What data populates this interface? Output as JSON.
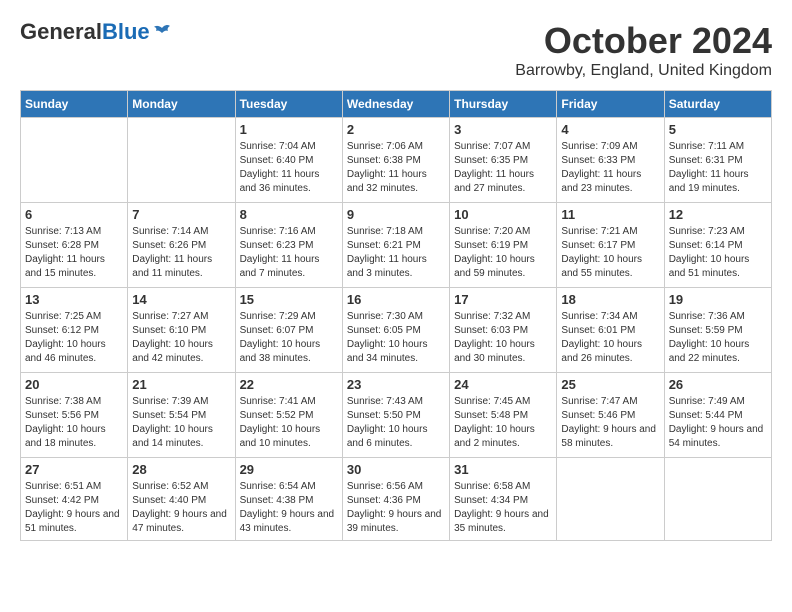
{
  "header": {
    "logo_general": "General",
    "logo_blue": "Blue",
    "month_title": "October 2024",
    "location": "Barrowby, England, United Kingdom"
  },
  "weekdays": [
    "Sunday",
    "Monday",
    "Tuesday",
    "Wednesday",
    "Thursday",
    "Friday",
    "Saturday"
  ],
  "weeks": [
    [
      {
        "day": "",
        "info": ""
      },
      {
        "day": "",
        "info": ""
      },
      {
        "day": "1",
        "info": "Sunrise: 7:04 AM\nSunset: 6:40 PM\nDaylight: 11 hours and 36 minutes."
      },
      {
        "day": "2",
        "info": "Sunrise: 7:06 AM\nSunset: 6:38 PM\nDaylight: 11 hours and 32 minutes."
      },
      {
        "day": "3",
        "info": "Sunrise: 7:07 AM\nSunset: 6:35 PM\nDaylight: 11 hours and 27 minutes."
      },
      {
        "day": "4",
        "info": "Sunrise: 7:09 AM\nSunset: 6:33 PM\nDaylight: 11 hours and 23 minutes."
      },
      {
        "day": "5",
        "info": "Sunrise: 7:11 AM\nSunset: 6:31 PM\nDaylight: 11 hours and 19 minutes."
      }
    ],
    [
      {
        "day": "6",
        "info": "Sunrise: 7:13 AM\nSunset: 6:28 PM\nDaylight: 11 hours and 15 minutes."
      },
      {
        "day": "7",
        "info": "Sunrise: 7:14 AM\nSunset: 6:26 PM\nDaylight: 11 hours and 11 minutes."
      },
      {
        "day": "8",
        "info": "Sunrise: 7:16 AM\nSunset: 6:23 PM\nDaylight: 11 hours and 7 minutes."
      },
      {
        "day": "9",
        "info": "Sunrise: 7:18 AM\nSunset: 6:21 PM\nDaylight: 11 hours and 3 minutes."
      },
      {
        "day": "10",
        "info": "Sunrise: 7:20 AM\nSunset: 6:19 PM\nDaylight: 10 hours and 59 minutes."
      },
      {
        "day": "11",
        "info": "Sunrise: 7:21 AM\nSunset: 6:17 PM\nDaylight: 10 hours and 55 minutes."
      },
      {
        "day": "12",
        "info": "Sunrise: 7:23 AM\nSunset: 6:14 PM\nDaylight: 10 hours and 51 minutes."
      }
    ],
    [
      {
        "day": "13",
        "info": "Sunrise: 7:25 AM\nSunset: 6:12 PM\nDaylight: 10 hours and 46 minutes."
      },
      {
        "day": "14",
        "info": "Sunrise: 7:27 AM\nSunset: 6:10 PM\nDaylight: 10 hours and 42 minutes."
      },
      {
        "day": "15",
        "info": "Sunrise: 7:29 AM\nSunset: 6:07 PM\nDaylight: 10 hours and 38 minutes."
      },
      {
        "day": "16",
        "info": "Sunrise: 7:30 AM\nSunset: 6:05 PM\nDaylight: 10 hours and 34 minutes."
      },
      {
        "day": "17",
        "info": "Sunrise: 7:32 AM\nSunset: 6:03 PM\nDaylight: 10 hours and 30 minutes."
      },
      {
        "day": "18",
        "info": "Sunrise: 7:34 AM\nSunset: 6:01 PM\nDaylight: 10 hours and 26 minutes."
      },
      {
        "day": "19",
        "info": "Sunrise: 7:36 AM\nSunset: 5:59 PM\nDaylight: 10 hours and 22 minutes."
      }
    ],
    [
      {
        "day": "20",
        "info": "Sunrise: 7:38 AM\nSunset: 5:56 PM\nDaylight: 10 hours and 18 minutes."
      },
      {
        "day": "21",
        "info": "Sunrise: 7:39 AM\nSunset: 5:54 PM\nDaylight: 10 hours and 14 minutes."
      },
      {
        "day": "22",
        "info": "Sunrise: 7:41 AM\nSunset: 5:52 PM\nDaylight: 10 hours and 10 minutes."
      },
      {
        "day": "23",
        "info": "Sunrise: 7:43 AM\nSunset: 5:50 PM\nDaylight: 10 hours and 6 minutes."
      },
      {
        "day": "24",
        "info": "Sunrise: 7:45 AM\nSunset: 5:48 PM\nDaylight: 10 hours and 2 minutes."
      },
      {
        "day": "25",
        "info": "Sunrise: 7:47 AM\nSunset: 5:46 PM\nDaylight: 9 hours and 58 minutes."
      },
      {
        "day": "26",
        "info": "Sunrise: 7:49 AM\nSunset: 5:44 PM\nDaylight: 9 hours and 54 minutes."
      }
    ],
    [
      {
        "day": "27",
        "info": "Sunrise: 6:51 AM\nSunset: 4:42 PM\nDaylight: 9 hours and 51 minutes."
      },
      {
        "day": "28",
        "info": "Sunrise: 6:52 AM\nSunset: 4:40 PM\nDaylight: 9 hours and 47 minutes."
      },
      {
        "day": "29",
        "info": "Sunrise: 6:54 AM\nSunset: 4:38 PM\nDaylight: 9 hours and 43 minutes."
      },
      {
        "day": "30",
        "info": "Sunrise: 6:56 AM\nSunset: 4:36 PM\nDaylight: 9 hours and 39 minutes."
      },
      {
        "day": "31",
        "info": "Sunrise: 6:58 AM\nSunset: 4:34 PM\nDaylight: 9 hours and 35 minutes."
      },
      {
        "day": "",
        "info": ""
      },
      {
        "day": "",
        "info": ""
      }
    ]
  ]
}
